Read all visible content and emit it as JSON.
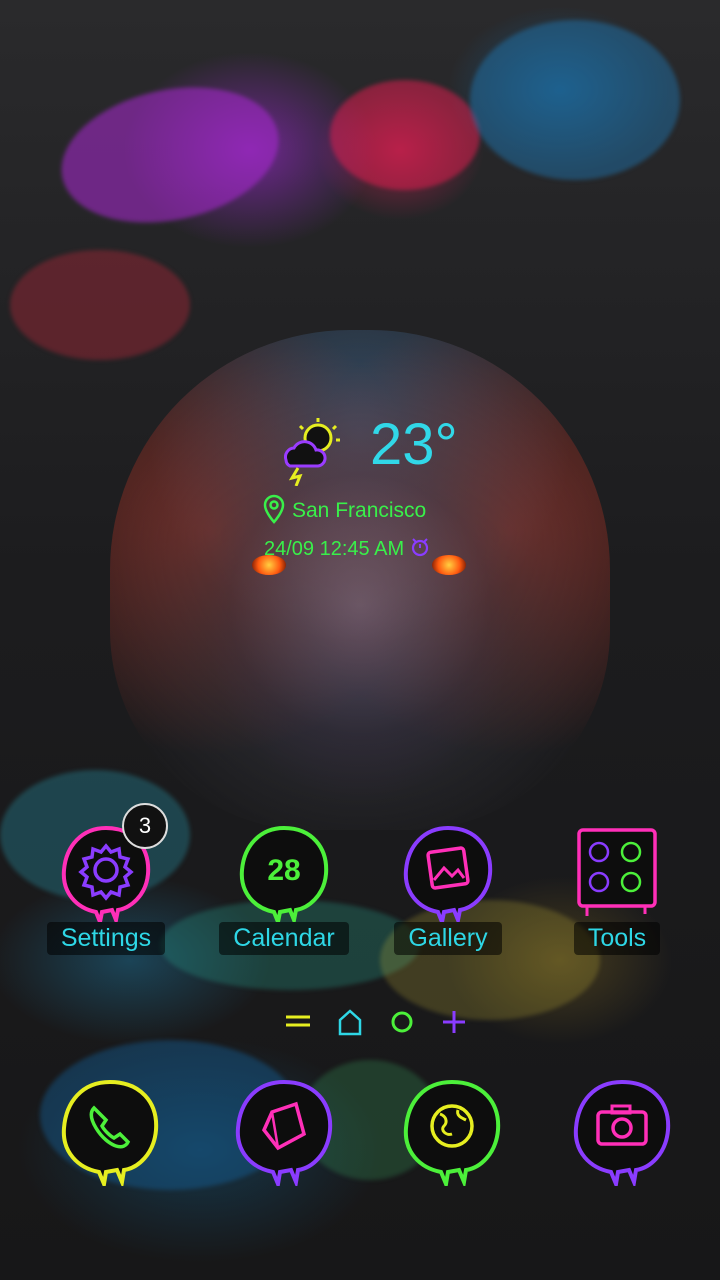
{
  "weather": {
    "temperature": "23°",
    "location": "San Francisco",
    "datetime": "24/09 12:45 AM",
    "icon": "sun-cloud-storm-icon"
  },
  "apps": [
    {
      "label": "Settings",
      "icon": "gear-icon",
      "badge": "3"
    },
    {
      "label": "Calendar",
      "icon": "calendar-icon",
      "day": "28"
    },
    {
      "label": "Gallery",
      "icon": "picture-icon"
    },
    {
      "label": "Tools",
      "icon": "folder-grid-icon"
    }
  ],
  "page_indicator": [
    "menu-lines-icon",
    "home-icon",
    "circle-icon",
    "plus-icon"
  ],
  "dock": [
    "phone-icon",
    "kite-icon",
    "globe-icon",
    "camera-icon"
  ],
  "colors": {
    "accent_cyan": "#2ed7e6",
    "accent_green": "#39f04a",
    "accent_pink": "#ff2fb8",
    "accent_purple": "#8a3cff"
  }
}
